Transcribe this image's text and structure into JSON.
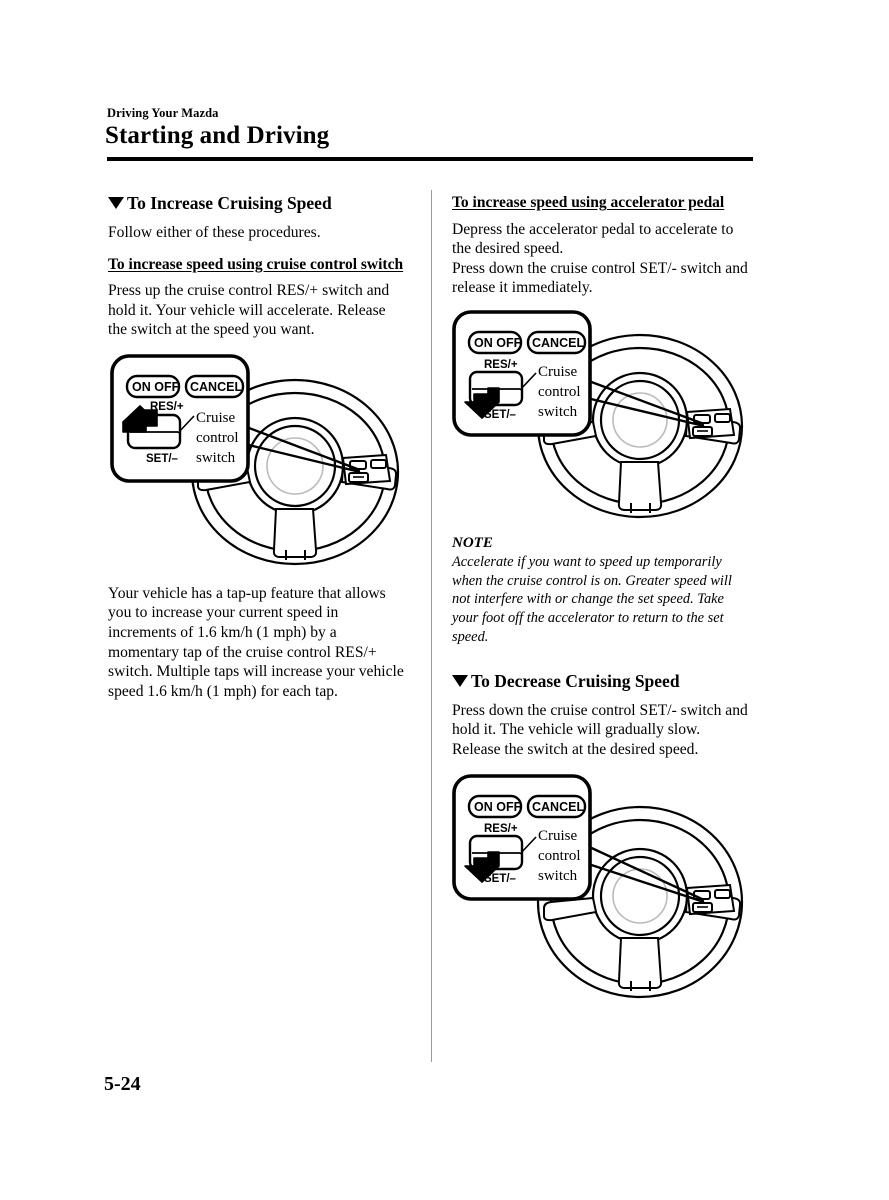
{
  "header": {
    "running_head": "Driving Your Mazda",
    "chapter_title": "Starting and Driving"
  },
  "page_number": "5-24",
  "left_column": {
    "section_heading": "To Increase Cruising Speed",
    "intro": "Follow either of these procedures.",
    "sub_heading": "To increase speed using cruise control switch",
    "paragraph_1": "Press up the cruise control RES/+ switch and hold it. Your vehicle will accelerate. Release the switch at the speed you want.",
    "paragraph_2": "Your vehicle has a tap-up feature that allows you to increase your current speed in increments of 1.6 km/h (1 mph) by a momentary tap of the cruise control RES/+ switch. Multiple taps will increase your vehicle speed 1.6 km/h (1 mph) for each tap."
  },
  "right_column": {
    "sub_heading": "To increase speed using accelerator pedal",
    "paragraph_1": "Depress the accelerator pedal to accelerate to the desired speed.",
    "paragraph_2": "Press down the cruise control SET/- switch and release it immediately.",
    "note_title": "NOTE",
    "note_body": "Accelerate if you want to speed up temporarily when the cruise control is on. Greater speed will not interfere with or change the set speed. Take your foot off the accelerator to return to the set speed.",
    "section_heading": "To Decrease Cruising Speed",
    "paragraph_3": "Press down the cruise control SET/- switch and hold it. The vehicle will gradually slow.",
    "paragraph_4": "Release the switch at the desired speed."
  },
  "figures": {
    "figure_1": {
      "on_off_label": "ON OFF",
      "cancel_label": "CANCEL",
      "res_label": "RES/+",
      "set_label": "SET/–",
      "callout_line_1": "Cruise",
      "callout_line_2": "control",
      "callout_line_3": "switch",
      "arrow_direction": "up"
    },
    "figure_2": {
      "on_off_label": "ON OFF",
      "cancel_label": "CANCEL",
      "res_label": "RES/+",
      "set_label": "SET/–",
      "callout_line_1": "Cruise",
      "callout_line_2": "control",
      "callout_line_3": "switch",
      "arrow_direction": "down"
    },
    "figure_3": {
      "on_off_label": "ON OFF",
      "cancel_label": "CANCEL",
      "res_label": "RES/+",
      "set_label": "SET/–",
      "callout_line_1": "Cruise",
      "callout_line_2": "control",
      "callout_line_3": "switch",
      "arrow_direction": "down"
    }
  },
  "colors": {
    "ink": "#000000",
    "paper": "#ffffff",
    "divider": "#9a9a9a"
  }
}
